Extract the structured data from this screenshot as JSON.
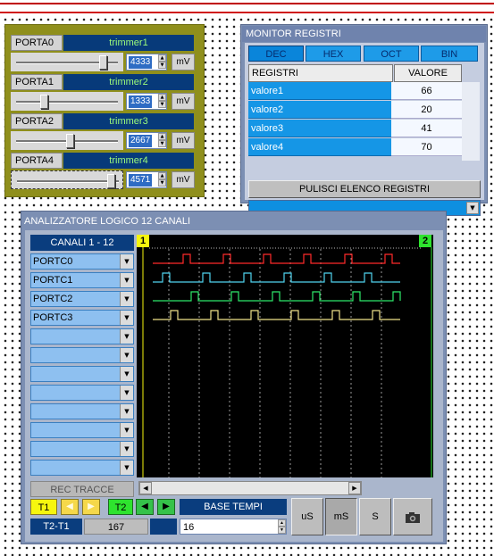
{
  "trimmers": [
    {
      "port": "PORTA0",
      "name": "trimmer1",
      "value": "4333",
      "unit": "mV",
      "level": 0.85
    },
    {
      "port": "PORTA1",
      "name": "trimmer2",
      "value": "1333",
      "unit": "mV",
      "level": 0.27
    },
    {
      "port": "PORTA2",
      "name": "trimmer3",
      "value": "2667",
      "unit": "mV",
      "level": 0.53
    },
    {
      "port": "PORTA4",
      "name": "trimmer4",
      "value": "4571",
      "unit": "mV",
      "level": 0.92
    }
  ],
  "monitor": {
    "title": "MONITOR REGISTRI",
    "formats": [
      "DEC",
      "HEX",
      "OCT",
      "BIN"
    ],
    "active_format": "DEC",
    "col_registri": "REGISTRI",
    "col_valore": "VALORE",
    "rows": [
      {
        "name": "valore1",
        "value": "66"
      },
      {
        "name": "valore2",
        "value": "20"
      },
      {
        "name": "valore3",
        "value": "41"
      },
      {
        "name": "valore4",
        "value": "70"
      }
    ],
    "clear_label": "PULISCI ELENCO REGISTRI"
  },
  "analyzer": {
    "title": "ANALIZZATORE LOGICO 12 CANALI",
    "channels_header": "CANALI 1 - 12",
    "channels": [
      "PORTC0",
      "PORTC1",
      "PORTC2",
      "PORTC3",
      "",
      "",
      "",
      "",
      "",
      "",
      "",
      ""
    ],
    "traces": [
      {
        "color": "#ff2a2a",
        "pulses": [
          52,
          97,
          142,
          187,
          233,
          278
        ]
      },
      {
        "color": "#4fd4f0",
        "pulses": [
          29,
          74,
          120,
          165,
          210,
          255
        ]
      },
      {
        "color": "#2ee86a",
        "pulses": [
          61,
          106,
          152,
          197,
          242,
          287
        ]
      },
      {
        "color": "#f0e28a",
        "pulses": [
          38,
          83,
          128,
          173,
          219,
          264
        ]
      }
    ],
    "cursor1": "1",
    "cursor2": "2",
    "rec_label": "REC TRACCE",
    "t1": "T1",
    "t2": "T2",
    "t2t1_label": "T2-T1",
    "t2t1_value": "167",
    "base_label": "BASE TEMPI",
    "base_value": "16",
    "unit_us": "uS",
    "unit_ms": "mS",
    "unit_s": "S",
    "colors": {
      "t1": "#f6f60e",
      "t2": "#2ee32e"
    }
  }
}
